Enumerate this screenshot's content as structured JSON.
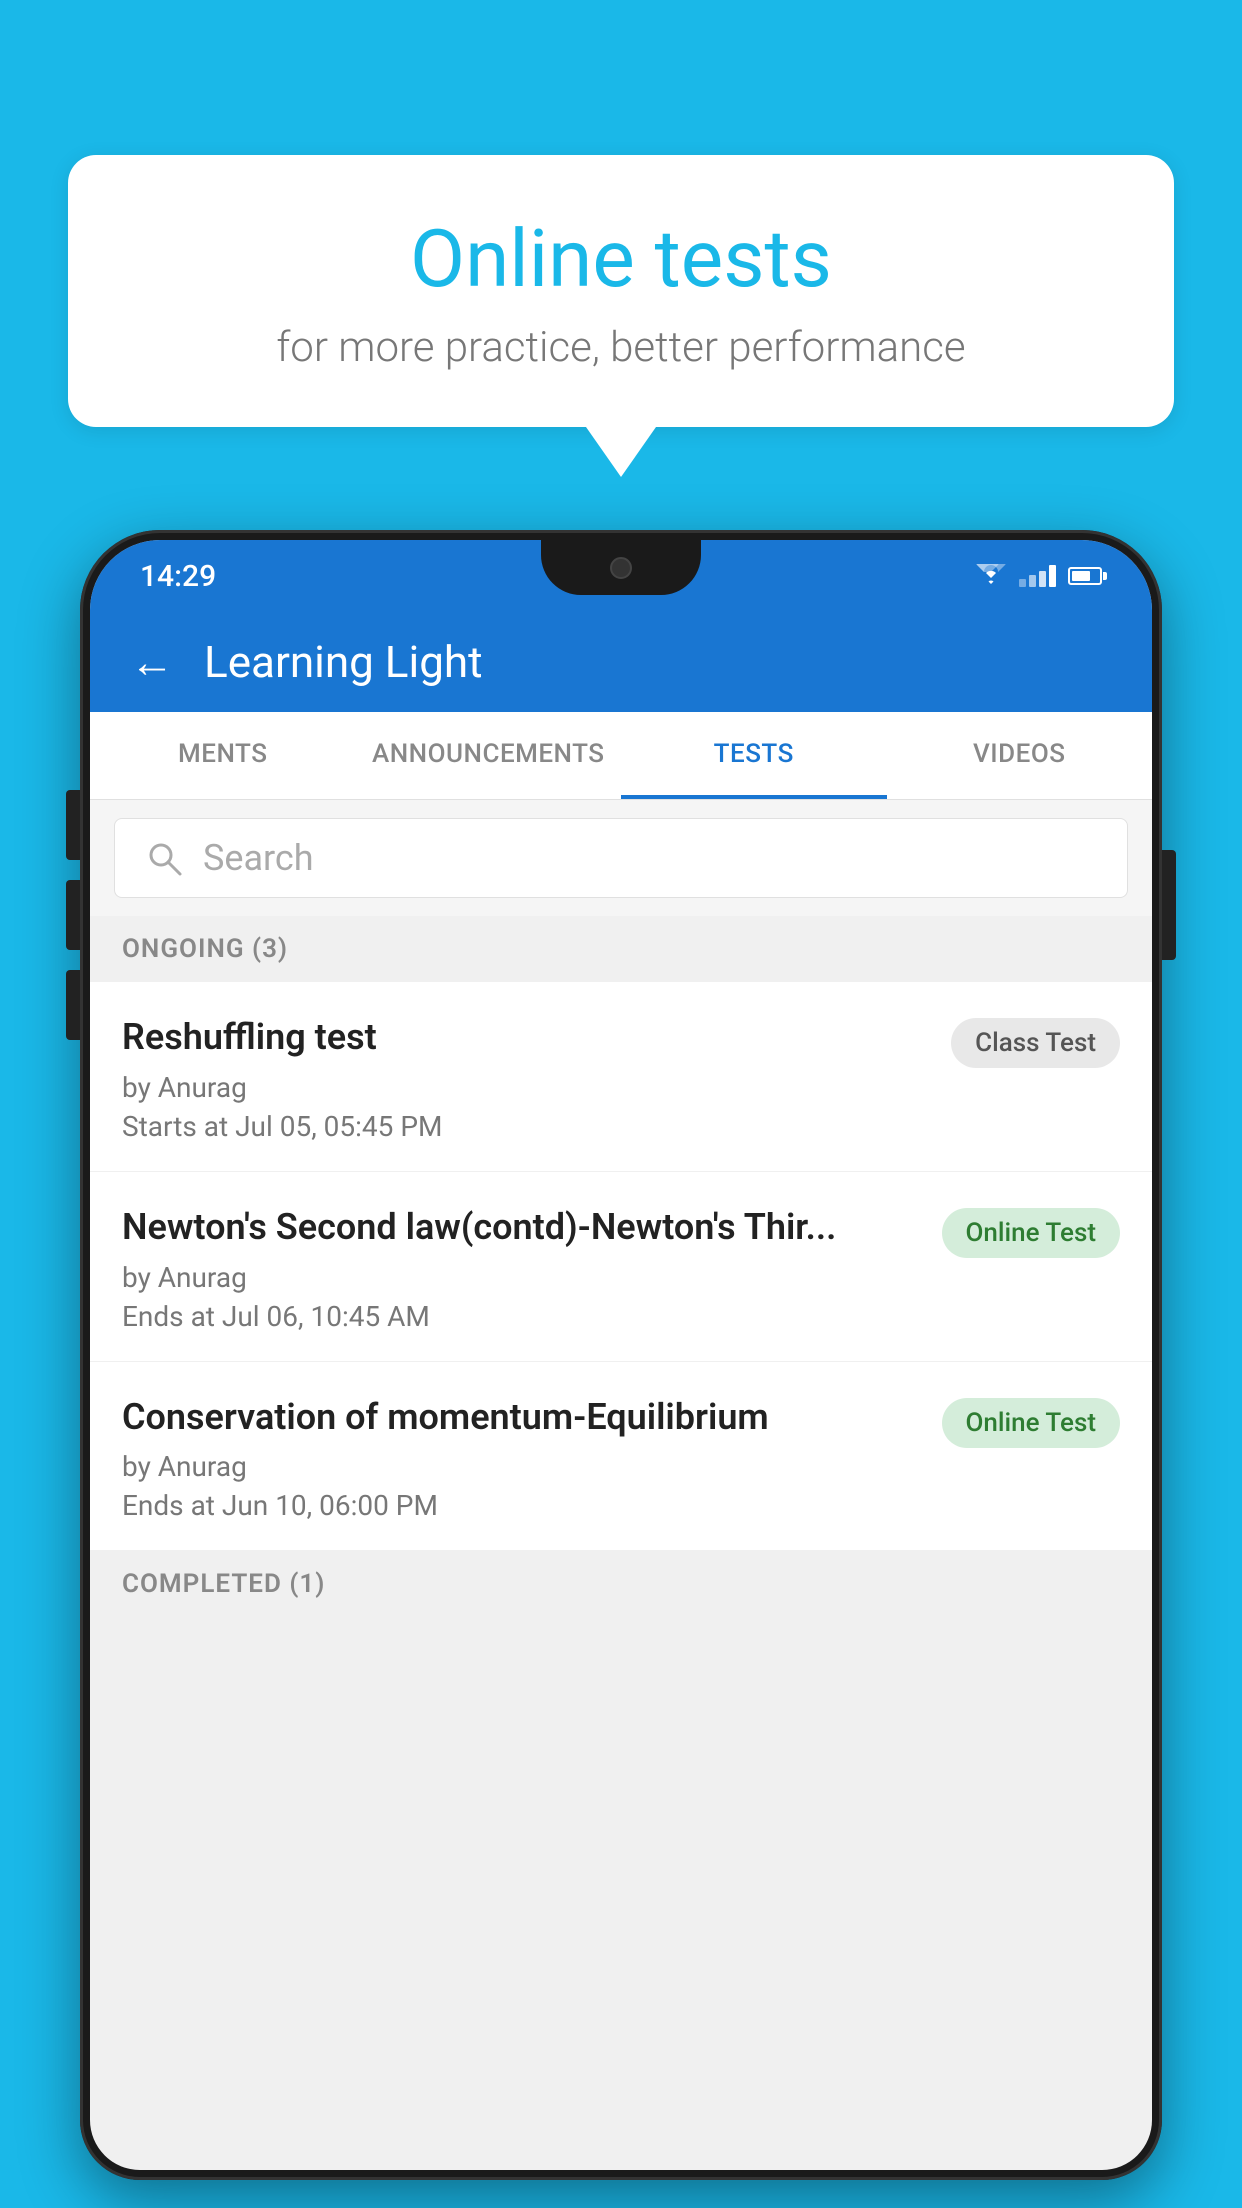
{
  "background": {
    "color": "#1ab8e8"
  },
  "speech_bubble": {
    "title": "Online tests",
    "subtitle": "for more practice, better performance"
  },
  "phone": {
    "status_bar": {
      "time": "14:29"
    },
    "app_bar": {
      "title": "Learning Light",
      "back_label": "←"
    },
    "tabs": [
      {
        "label": "MENTS",
        "active": false
      },
      {
        "label": "ANNOUNCEMENTS",
        "active": false
      },
      {
        "label": "TESTS",
        "active": true
      },
      {
        "label": "VIDEOS",
        "active": false
      }
    ],
    "search": {
      "placeholder": "Search"
    },
    "ongoing_section": {
      "label": "ONGOING (3)"
    },
    "tests": [
      {
        "title": "Reshuffling test",
        "author": "by Anurag",
        "date": "Starts at  Jul 05, 05:45 PM",
        "badge": "Class Test",
        "badge_type": "class"
      },
      {
        "title": "Newton's Second law(contd)-Newton's Thir...",
        "author": "by Anurag",
        "date": "Ends at  Jul 06, 10:45 AM",
        "badge": "Online Test",
        "badge_type": "online"
      },
      {
        "title": "Conservation of momentum-Equilibrium",
        "author": "by Anurag",
        "date": "Ends at  Jun 10, 06:00 PM",
        "badge": "Online Test",
        "badge_type": "online"
      }
    ],
    "completed_section": {
      "label": "COMPLETED (1)"
    }
  }
}
